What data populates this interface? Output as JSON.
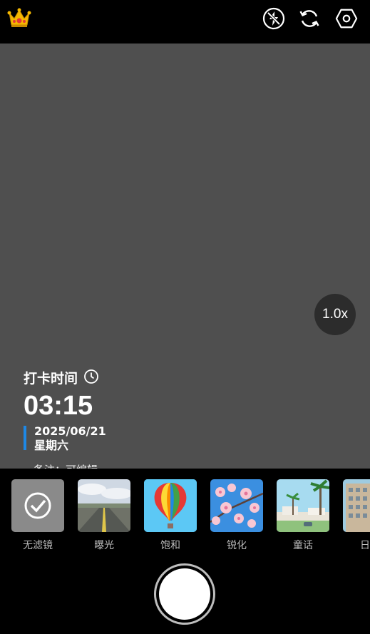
{
  "topbar": {
    "crown_icon": "crown-icon",
    "flash_icon": "flash-off-icon",
    "switch_icon": "switch-camera-icon",
    "settings_icon": "settings-hexagon-icon"
  },
  "viewfinder": {
    "zoom_label": "1.0x",
    "watermark": {
      "title": "打卡时间",
      "time": "03:15",
      "date": "2025/06/21",
      "weekday": "星期六",
      "note": "备注：可编辑"
    }
  },
  "filters": [
    {
      "label": "无滤镜",
      "selected": true
    },
    {
      "label": "曝光",
      "selected": false
    },
    {
      "label": "饱和",
      "selected": false
    },
    {
      "label": "锐化",
      "selected": false
    },
    {
      "label": "童话",
      "selected": false
    },
    {
      "label": "日",
      "selected": false
    }
  ],
  "colors": {
    "accent": "#1e88e5",
    "viewfinder_bg": "#4f4f4f",
    "crown": "#f5b800"
  }
}
